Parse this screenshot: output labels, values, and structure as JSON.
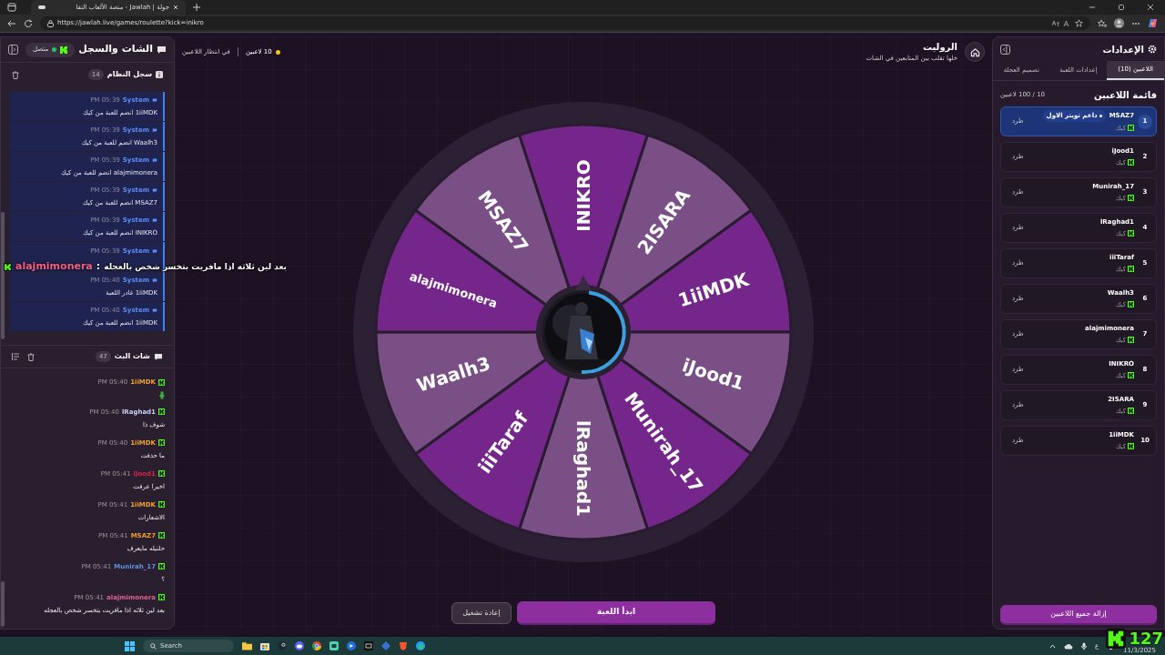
{
  "browser": {
    "tab_title": "جولة | Jawlah - منصة الألعاب التفا",
    "url": "https://jawlah.live/games/roulette?kick=inikro"
  },
  "chat_panel": {
    "title": "الشات والسجل",
    "connection": "متصل",
    "connected": true,
    "system_log": {
      "title": "سجل النظام",
      "count": "14",
      "entries": [
        {
          "sender": "System",
          "time": "05:39 PM",
          "message": "1iiMDK انضم للعبة من كيك"
        },
        {
          "sender": "System",
          "time": "05:39 PM",
          "message": "Waalh3 انضم للعبة من كيك"
        },
        {
          "sender": "System",
          "time": "05:39 PM",
          "message": "alajmimonera انضم للعبة من كيك"
        },
        {
          "sender": "System",
          "time": "05:39 PM",
          "message": "MSAZ7 انضم للعبة من كيك"
        },
        {
          "sender": "System",
          "time": "05:39 PM",
          "message": "INIKRO انضم للعبة من كيك"
        },
        {
          "sender": "System",
          "time": "05:39 PM"
        },
        {
          "sender": "System",
          "time": "05:40 PM",
          "message": "1iiMDK غادر اللعبة"
        },
        {
          "sender": "System",
          "time": "05:40 PM",
          "message": "1iiMDK انضم للعبة من كيك"
        }
      ]
    },
    "stream_chat": {
      "title": "شات البث",
      "count": "47",
      "messages": [
        {
          "kind": "emote",
          "user": "1iiMDK",
          "color": "#f0a030",
          "time": "05:40 PM"
        },
        {
          "kind": "text",
          "user": "lRaghad1",
          "color": "#c8d0f0",
          "time": "05:40 PM",
          "message": "شوف ذا"
        },
        {
          "kind": "text",
          "user": "1iiMDK",
          "color": "#f0a030",
          "time": "05:40 PM",
          "message": "ما حذفت"
        },
        {
          "kind": "text",
          "user": "iJood1",
          "color": "#e0204a",
          "time": "05:41 PM",
          "message": "اخيرا عرفت"
        },
        {
          "kind": "text",
          "user": "1iiMDK",
          "color": "#f0a030",
          "time": "05:41 PM",
          "message": "الاشعارات"
        },
        {
          "kind": "text",
          "user": "MSAZ7",
          "color": "#f0a030",
          "time": "05:41 PM",
          "message": "حلتيله مايعرف"
        },
        {
          "kind": "text",
          "user": "Munirah_17",
          "color": "#6090e0",
          "time": "05:41 PM",
          "message": "؟"
        },
        {
          "kind": "text",
          "user": "alajmimonera",
          "color": "#e06090",
          "time": "05:41 PM",
          "message": "بعد لين ثلاثه اذا مافريت بتخسر شخص بالعجله"
        }
      ]
    }
  },
  "game": {
    "status": {
      "players": "10 لاعبين",
      "state": "في انتظار اللاعبين"
    },
    "title": "الروليت",
    "subtitle": "خلها تقلب بين المتابعين في الشات",
    "wheel": {
      "segments": [
        "INIKRO",
        "2ISARA",
        "1iiMDK",
        "iJood1",
        "Munirah_17",
        "lRaghad1",
        "iiiTaraf",
        "Waalh3",
        "alajmimonera",
        "MSAZ7"
      ]
    },
    "buttons": {
      "restart": "إعادة تشغيل",
      "start": "ابدأ اللعبة"
    }
  },
  "settings": {
    "title": "الإعدادات",
    "tabs": [
      {
        "label": "اللاعبين (10)",
        "selected": true
      },
      {
        "label": "إعدادات اللعبة",
        "selected": false
      },
      {
        "label": "تصميم العجلة",
        "selected": false
      }
    ],
    "list_title": "قائمة اللاعبين",
    "capacity": "10 / 100 لاعبين",
    "players": [
      {
        "rank": "1",
        "name": "MSAZ7",
        "platform": "كيك",
        "badge": "داعم تويتر الاول",
        "selected": true,
        "action": "طرد"
      },
      {
        "rank": "2",
        "name": "iJood1",
        "platform": "كيك",
        "selected": false,
        "action": "طرد"
      },
      {
        "rank": "3",
        "name": "Munirah_17",
        "platform": "كيك",
        "selected": false,
        "action": "طرد"
      },
      {
        "rank": "4",
        "name": "lRaghad1",
        "platform": "كيك",
        "selected": false,
        "action": "طرد"
      },
      {
        "rank": "5",
        "name": "iiiTaraf",
        "platform": "كيك",
        "selected": false,
        "action": "طرد"
      },
      {
        "rank": "6",
        "name": "Waalh3",
        "platform": "كيك",
        "selected": false,
        "action": "طرد"
      },
      {
        "rank": "7",
        "name": "alajmimonera",
        "platform": "كيك",
        "selected": false,
        "action": "طرد"
      },
      {
        "rank": "8",
        "name": "INIKRO",
        "platform": "كيك",
        "selected": false,
        "action": "طرد"
      },
      {
        "rank": "9",
        "name": "2ISARA",
        "platform": "كيك",
        "selected": false,
        "action": "طرد"
      },
      {
        "rank": "10",
        "name": "1iiMDK",
        "platform": "كيك",
        "selected": false,
        "action": "طرد"
      }
    ],
    "remove_all": "إزالة جميع اللاعبين"
  },
  "overlay": {
    "user": "alajmimonera",
    "separator": ":",
    "message": "بعد لين ثلاثه اذا مافريت بتخسر شخص بالعجله",
    "counter": "127"
  },
  "taskbar": {
    "search": "Search",
    "tray_language": "ع",
    "date": "11/3/2025"
  }
}
